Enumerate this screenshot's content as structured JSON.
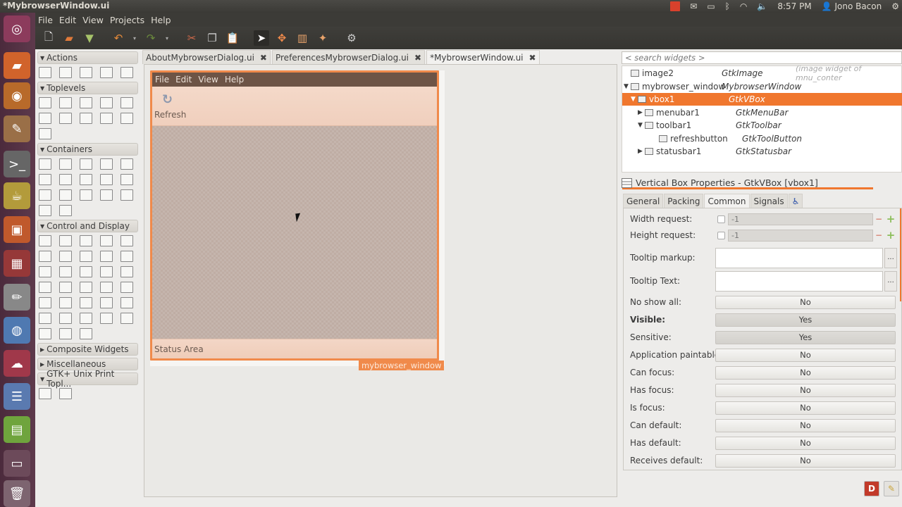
{
  "window": {
    "title": "*MybrowserWindow.ui"
  },
  "tray": {
    "time": "8:57 PM",
    "user": "Jono Bacon",
    "icons": [
      "notification-icon",
      "mail-icon",
      "battery-icon",
      "bluetooth-icon",
      "wifi-icon",
      "volume-icon",
      "user-icon",
      "gear-icon"
    ]
  },
  "menu": [
    "File",
    "Edit",
    "View",
    "Projects",
    "Help"
  ],
  "toolbar": [
    "new-icon",
    "open-icon",
    "save-icon",
    "undo-icon",
    "undo-dropdown",
    "redo-icon",
    "redo-dropdown",
    "cut-icon",
    "copy-icon",
    "paste-icon",
    "select-pointer-icon",
    "drag-resize-icon",
    "layout-icon",
    "wand-icon",
    "preferences-icon"
  ],
  "launcher": [
    "ubuntu-dash",
    "files",
    "firefox",
    "gimp",
    "terminal",
    "teapot",
    "sound-juicer",
    "workspace-switcher",
    "text-editor",
    "chromium",
    "ubuntu-one",
    "glade-list",
    "libreoffice-calc",
    "glade-designer",
    "trash"
  ],
  "palette": {
    "groups": [
      {
        "label": "Actions",
        "expanded": true,
        "items": [
          "action",
          "toggle-action",
          "radio-action",
          "recent-action",
          "action-group"
        ]
      },
      {
        "label": "Toplevels",
        "expanded": true,
        "items": [
          "window",
          "offscreen-window",
          "dialog",
          "about-dialog",
          "color-selection-dialog",
          "file-chooser-dialog",
          "font-selection-dialog",
          "input-dialog",
          "message-dialog",
          "recent-chooser-dialog",
          "assistant"
        ]
      },
      {
        "label": "Containers",
        "expanded": true,
        "items": [
          "vbox",
          "table",
          "notebook",
          "frame",
          "layout",
          "menubar",
          "hbox",
          "toolbar",
          "hpaned",
          "hbuttonbox",
          "scrolled-window",
          "viewport",
          "event-box",
          "expander",
          "alignment",
          "fixed",
          "toolpalette"
        ]
      },
      {
        "label": "Control and Display",
        "expanded": true,
        "items": [
          "button",
          "toggle-button",
          "check-button",
          "radio-button",
          "switch",
          "entry",
          "spin-button",
          "combo-box",
          "combo-box-entry",
          "image",
          "label",
          "accel-label",
          "file-chooser-button",
          "color-button",
          "font-button",
          "link-button",
          "scale-button",
          "volume-button",
          "hscale",
          "vscale",
          "vscrollbar",
          "progressbar",
          "spinner",
          "textview",
          "treeview",
          "iconview",
          "hseparator",
          "calendar",
          "ruler",
          "vseparator",
          "arrow",
          "drawing-area",
          "info-bar"
        ]
      },
      {
        "label": "Composite Widgets",
        "expanded": false,
        "items": []
      },
      {
        "label": "Miscellaneous",
        "expanded": false,
        "items": []
      },
      {
        "label": "GTK+ Unix Print Topl...",
        "expanded": true,
        "items": [
          "page-setup-dialog",
          "print-dialog"
        ]
      }
    ]
  },
  "tabs": [
    {
      "label": "AboutMybrowserDialog.ui",
      "active": false
    },
    {
      "label": "PreferencesMybrowserDialog.ui",
      "active": false
    },
    {
      "label": "*MybrowserWindow.ui",
      "active": true
    }
  ],
  "design": {
    "menu": [
      "File",
      "Edit",
      "View",
      "Help"
    ],
    "tool_label": "Refresh",
    "status_label": "Status Area",
    "window_name": "mybrowser_window"
  },
  "inspector": {
    "search_placeholder": "< search widgets >",
    "rows": [
      {
        "name": "image2",
        "type": "GtkImage",
        "comment": "(image widget of mnu_conter",
        "depth": 0,
        "expander": "",
        "selected": false
      },
      {
        "name": "mybrowser_window",
        "type": "MybrowserWindow",
        "comment": "",
        "depth": 0,
        "expander": "▼",
        "selected": false
      },
      {
        "name": "vbox1",
        "type": "GtkVBox",
        "comment": "",
        "depth": 1,
        "expander": "▼",
        "selected": true
      },
      {
        "name": "menubar1",
        "type": "GtkMenuBar",
        "comment": "",
        "depth": 2,
        "expander": "▶",
        "selected": false
      },
      {
        "name": "toolbar1",
        "type": "GtkToolbar",
        "comment": "",
        "depth": 2,
        "expander": "▼",
        "selected": false
      },
      {
        "name": "refreshbutton",
        "type": "GtkToolButton",
        "comment": "",
        "depth": 3,
        "expander": "",
        "selected": false
      },
      {
        "name": "statusbar1",
        "type": "GtkStatusbar",
        "comment": "",
        "depth": 2,
        "expander": "▶",
        "selected": false
      }
    ]
  },
  "properties": {
    "title": "Vertical Box Properties - GtkVBox [vbox1]",
    "tabs": [
      {
        "label": "General",
        "active": false
      },
      {
        "label": "Packing",
        "active": false
      },
      {
        "label": "Common",
        "active": true
      },
      {
        "label": "Signals",
        "active": false
      }
    ],
    "width_request": {
      "label": "Width request:",
      "value": "-1"
    },
    "height_request": {
      "label": "Height request:",
      "value": "-1"
    },
    "tooltip_markup": {
      "label": "Tooltip markup:",
      "value": "",
      "button": "..."
    },
    "tooltip_text": {
      "label": "Tooltip Text:",
      "value": "",
      "button": "..."
    },
    "toggles": [
      {
        "label": "No show all:",
        "value": "No",
        "bold": false,
        "on": false
      },
      {
        "label": "Visible:",
        "value": "Yes",
        "bold": true,
        "on": true
      },
      {
        "label": "Sensitive:",
        "value": "Yes",
        "bold": false,
        "on": true
      },
      {
        "label": "Application paintable:",
        "value": "No",
        "bold": false,
        "on": false
      },
      {
        "label": "Can focus:",
        "value": "No",
        "bold": false,
        "on": false
      },
      {
        "label": "Has focus:",
        "value": "No",
        "bold": false,
        "on": false
      },
      {
        "label": "Is focus:",
        "value": "No",
        "bold": false,
        "on": false
      },
      {
        "label": "Can default:",
        "value": "No",
        "bold": false,
        "on": false
      },
      {
        "label": "Has default:",
        "value": "No",
        "bold": false,
        "on": false
      },
      {
        "label": "Receives default:",
        "value": "No",
        "bold": false,
        "on": false
      }
    ]
  },
  "bottom_buttons": [
    {
      "name": "devhelp-button",
      "glyph": "D"
    },
    {
      "name": "clear-button",
      "glyph": "🧹"
    }
  ],
  "colors": {
    "accent": "#f0772e",
    "selection": "#f08a4b",
    "topbar": "#3c3b37"
  }
}
